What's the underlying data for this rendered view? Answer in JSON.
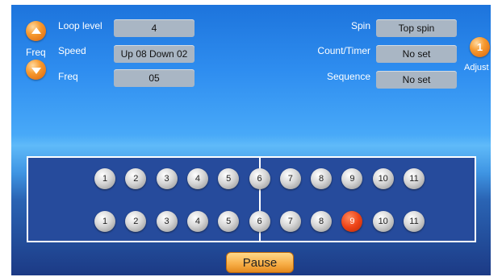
{
  "left_controls": {
    "freq_side_label": "Freq",
    "loop_level_label": "Loop level",
    "loop_level_value": "4",
    "speed_label": "Speed",
    "speed_value": "Up 08 Down 02",
    "freq_label": "Freq",
    "freq_value": "05"
  },
  "right_controls": {
    "spin_label": "Spin",
    "spin_value": "Top spin",
    "count_label": "Count/Timer",
    "count_value": "No set",
    "sequence_label": "Sequence",
    "sequence_value": "No set",
    "adjust_value": "1",
    "adjust_label": "Adjust"
  },
  "table": {
    "rows": [
      {
        "balls": [
          "1",
          "2",
          "3",
          "4",
          "5",
          "6",
          "7",
          "8",
          "9",
          "10",
          "11"
        ],
        "active_index": -1
      },
      {
        "balls": [
          "1",
          "2",
          "3",
          "4",
          "5",
          "6",
          "7",
          "8",
          "9",
          "10",
          "11"
        ],
        "active_index": 8
      }
    ]
  },
  "pause_label": "Pause",
  "colors": {
    "accent": "#f28a25",
    "table": "#264b9c",
    "active_ball": "#ee4418"
  }
}
